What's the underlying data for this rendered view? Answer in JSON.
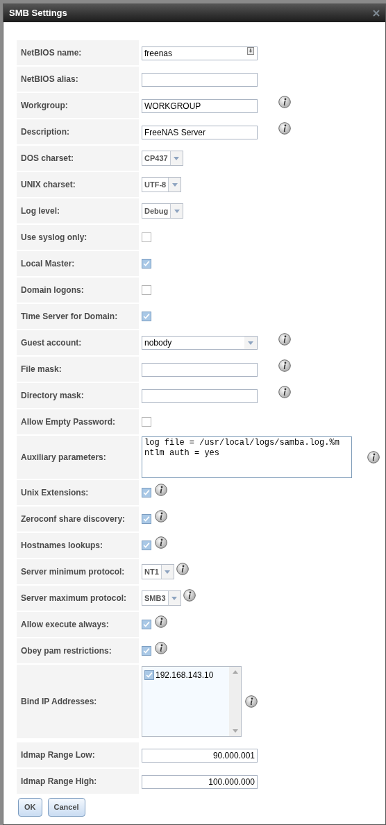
{
  "window": {
    "title": "SMB Settings"
  },
  "fields": [
    {
      "label": "NetBIOS name:",
      "kind": "text",
      "value": "freenas",
      "info": false,
      "field_icon": true
    },
    {
      "label": "NetBIOS alias:",
      "kind": "text",
      "info": false
    },
    {
      "label": "Workgroup:",
      "kind": "text",
      "value": "WORKGROUP",
      "info": true
    },
    {
      "label": "Description:",
      "kind": "text",
      "value": "FreeNAS Server",
      "info": true
    },
    {
      "label": "DOS charset:",
      "kind": "select",
      "value": "CP437",
      "info": false
    },
    {
      "label": "UNIX charset:",
      "kind": "select",
      "value": "UTF-8",
      "info": false
    },
    {
      "label": "Log level:",
      "kind": "select",
      "value": "Debug",
      "info": false
    },
    {
      "label": "Use syslog only:",
      "kind": "checkbox",
      "checked": false,
      "info": false
    },
    {
      "label": "Local Master:",
      "kind": "checkbox",
      "checked": true,
      "info": false
    },
    {
      "label": "Domain logons:",
      "kind": "checkbox",
      "checked": false,
      "info": false
    },
    {
      "label": "Time Server for Domain:",
      "kind": "checkbox",
      "checked": true,
      "info": false
    },
    {
      "label": "Guest account:",
      "kind": "combo",
      "value": "nobody",
      "info": true
    },
    {
      "label": "File mask:",
      "kind": "text",
      "info": true
    },
    {
      "label": "Directory mask:",
      "kind": "text",
      "info": true
    },
    {
      "label": "Allow Empty Password:",
      "kind": "checkbox",
      "checked": false,
      "info": false
    },
    {
      "label": "Auxiliary parameters:",
      "kind": "textarea",
      "value": "log file = /usr/local/logs/samba.log.%m\nntlm auth = yes",
      "info": true
    },
    {
      "label": "Unix Extensions:",
      "kind": "checkbox",
      "checked": true,
      "info": true
    },
    {
      "label": "Zeroconf share discovery:",
      "kind": "checkbox",
      "checked": true,
      "info": true
    },
    {
      "label": "Hostnames lookups:",
      "kind": "checkbox",
      "checked": true,
      "info": true
    },
    {
      "label": "Server minimum protocol:",
      "kind": "select",
      "value": "NT1",
      "info": true
    },
    {
      "label": "Server maximum protocol:",
      "kind": "select",
      "value": "SMB3",
      "info": true
    },
    {
      "label": "Allow execute always:",
      "kind": "checkbox",
      "checked": true,
      "info": true
    },
    {
      "label": "Obey pam restrictions:",
      "kind": "checkbox",
      "checked": true,
      "info": true
    },
    {
      "label": "Bind IP Addresses:",
      "kind": "multiselect",
      "items": [
        {
          "label": "192.168.143.10",
          "checked": true
        }
      ],
      "info": true
    },
    {
      "label": "Idmap Range Low:",
      "kind": "number",
      "value": "90.000.001",
      "info": false
    },
    {
      "label": "Idmap Range High:",
      "kind": "number",
      "value": "100.000.000",
      "info": false
    }
  ],
  "buttons": [
    "OK",
    "Cancel"
  ]
}
